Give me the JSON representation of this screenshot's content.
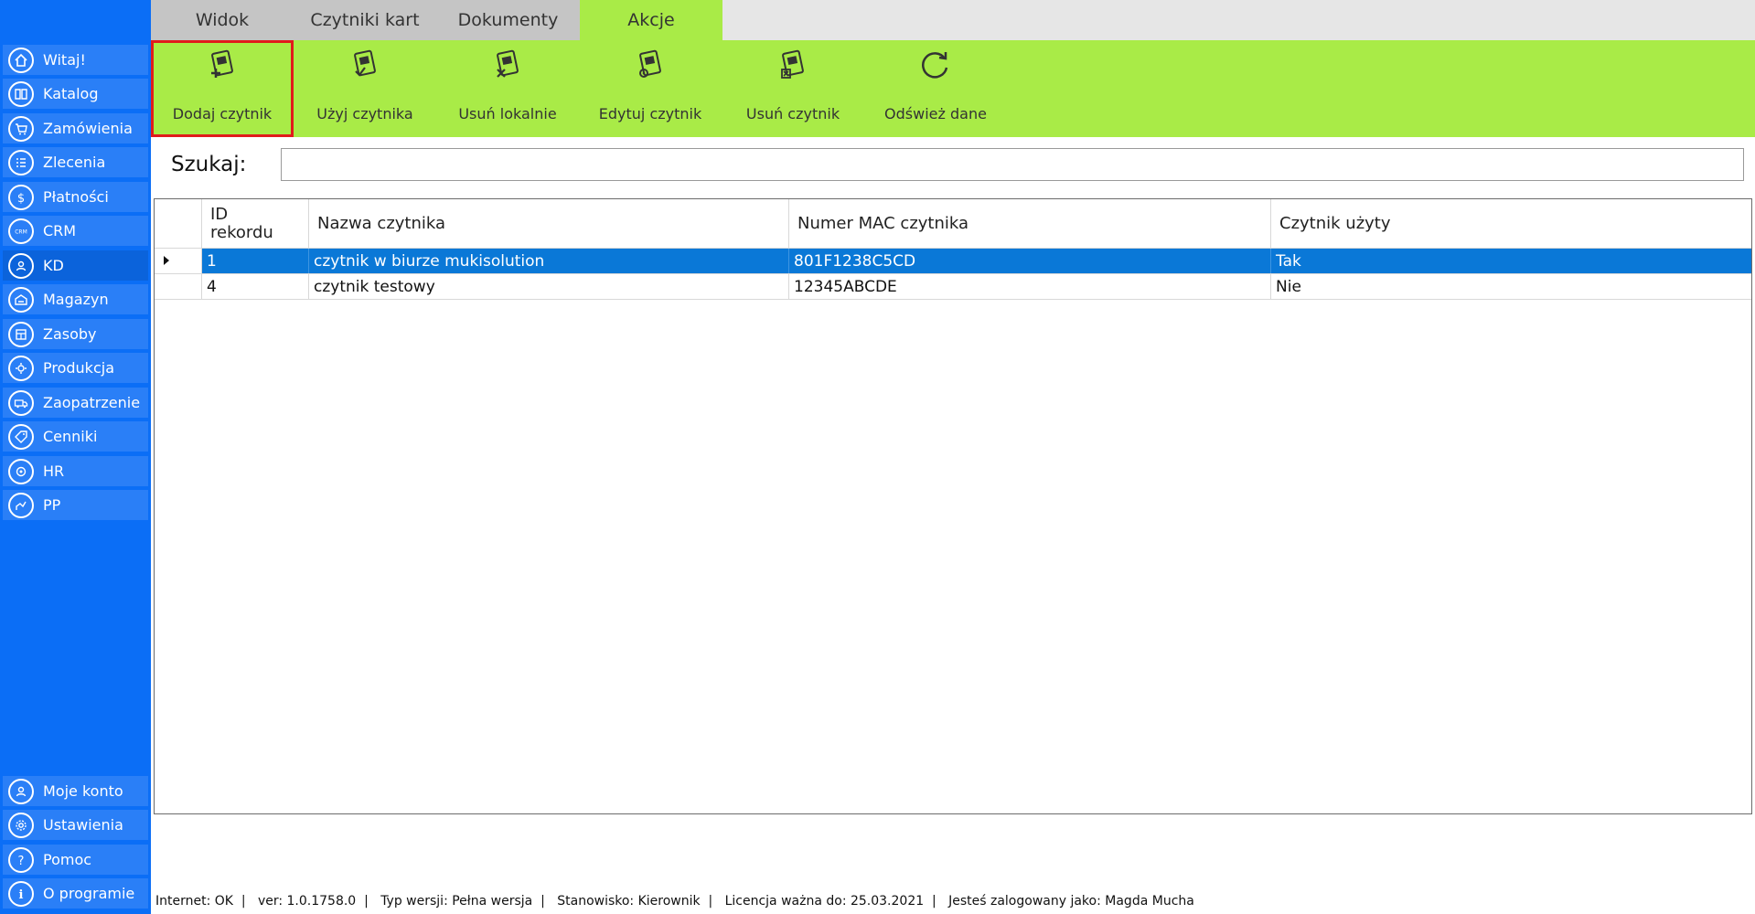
{
  "sidebar": {
    "items": [
      {
        "label": "Witaj!",
        "icon": "home-icon"
      },
      {
        "label": "Katalog",
        "icon": "book-icon"
      },
      {
        "label": "Zamówienia",
        "icon": "cart-icon"
      },
      {
        "label": "Zlecenia",
        "icon": "list-icon"
      },
      {
        "label": "Płatności",
        "icon": "dollar-icon"
      },
      {
        "label": "CRM",
        "icon": "crm-icon"
      },
      {
        "label": "KD",
        "icon": "user-badge-icon"
      },
      {
        "label": "Magazyn",
        "icon": "warehouse-icon"
      },
      {
        "label": "Zasoby",
        "icon": "resources-icon"
      },
      {
        "label": "Produkcja",
        "icon": "production-icon"
      },
      {
        "label": "Zaopatrzenie",
        "icon": "truck-icon"
      },
      {
        "label": "Cenniki",
        "icon": "tag-icon"
      },
      {
        "label": "HR",
        "icon": "hr-icon"
      },
      {
        "label": "PP",
        "icon": "pp-icon"
      }
    ],
    "bottom_items": [
      {
        "label": "Moje konto",
        "icon": "account-icon"
      },
      {
        "label": "Ustawienia",
        "icon": "settings-icon"
      },
      {
        "label": "Pomoc",
        "icon": "help-icon"
      },
      {
        "label": "O programie",
        "icon": "info-icon"
      }
    ],
    "active_index": 6
  },
  "tabs": [
    {
      "label": "Widok"
    },
    {
      "label": "Czytniki kart"
    },
    {
      "label": "Dokumenty"
    },
    {
      "label": "Akcje"
    }
  ],
  "active_tab": 3,
  "ribbon": {
    "buttons": [
      {
        "label": "Dodaj czytnik",
        "icon": "add-reader-icon"
      },
      {
        "label": "Użyj czytnika",
        "icon": "use-reader-icon"
      },
      {
        "label": "Usuń lokalnie",
        "icon": "remove-local-icon"
      },
      {
        "label": "Edytuj czytnik",
        "icon": "edit-reader-icon"
      },
      {
        "label": "Usuń czytnik",
        "icon": "delete-reader-icon"
      },
      {
        "label": "Odśwież dane",
        "icon": "refresh-icon"
      }
    ],
    "selected_index": 0
  },
  "search": {
    "label": "Szukaj:",
    "value": ""
  },
  "grid": {
    "columns": [
      "ID\nrekordu",
      "Nazwa czytnika",
      "Numer MAC czytnika",
      "Czytnik użyty"
    ],
    "rows": [
      [
        "1",
        "czytnik w biurze mukisolution",
        "801F1238C5CD",
        "Tak"
      ],
      [
        "4",
        "czytnik testowy",
        "12345ABCDE",
        "Nie"
      ]
    ],
    "selected_row": 0
  },
  "status": {
    "internet": "Internet: OK",
    "version": "ver: 1.0.1758.0",
    "type": "Typ wersji: Pełna wersja",
    "role": "Stanowisko: Kierownik",
    "license": "Licencja ważna do: 25.03.2021",
    "user": "Jesteś zalogowany jako: Magda Mucha"
  },
  "colors": {
    "sidebar": "#0b6ef6",
    "ribbon": "#a9eb47",
    "selection": "#0a78d7",
    "highlight": "#e11b1b"
  }
}
